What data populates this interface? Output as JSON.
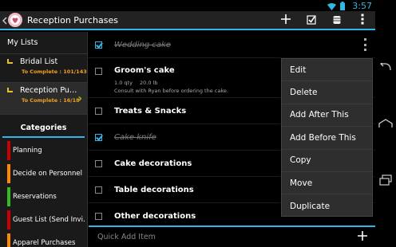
{
  "status_bar": {
    "time": "3:57",
    "icons": [
      "wifi-icon",
      "battery-icon"
    ]
  },
  "action_bar": {
    "title": "Reception Purchases",
    "actions": [
      "add-icon",
      "checklist-icon",
      "stack-icon",
      "overflow-icon"
    ]
  },
  "sidebar": {
    "my_lists_label": "My Lists",
    "lists": [
      {
        "name": "Bridal List",
        "sub": "To Complete : 101/143"
      },
      {
        "name": "Reception Pu…",
        "sub": "To Complete : 16/18"
      }
    ],
    "categories_label": "Categories",
    "categories": [
      {
        "label": "Planning",
        "color": "#cc0000"
      },
      {
        "label": "Decide on Personnel",
        "color": "#ff8800"
      },
      {
        "label": "Reservations",
        "color": "#33bb22"
      },
      {
        "label": "Guest List (Send Invi…",
        "color": "#cc0000"
      },
      {
        "label": "Apparel Purchases",
        "color": "#ff8800"
      }
    ]
  },
  "items": [
    {
      "name": "Wedding cake",
      "checked": true
    },
    {
      "name": "Groom's cake",
      "checked": false,
      "qty": "1.0 qty",
      "weight": "20.0 lb",
      "note": "Consult with Ryan before ordering the cake."
    },
    {
      "name": "Treats & Snacks",
      "checked": false
    },
    {
      "name": "Cake knife",
      "checked": true
    },
    {
      "name": "Cake decorations",
      "checked": false
    },
    {
      "name": "Table decorations",
      "checked": false
    },
    {
      "name": "Other decorations",
      "checked": false
    }
  ],
  "context_menu": [
    "Edit",
    "Delete",
    "Add After This",
    "Add Before This",
    "Copy",
    "Move",
    "Duplicate"
  ],
  "quick_add": {
    "placeholder": "Quick Add Item"
  },
  "nav_bar": [
    "back-icon",
    "home-icon",
    "recent-apps-icon"
  ]
}
